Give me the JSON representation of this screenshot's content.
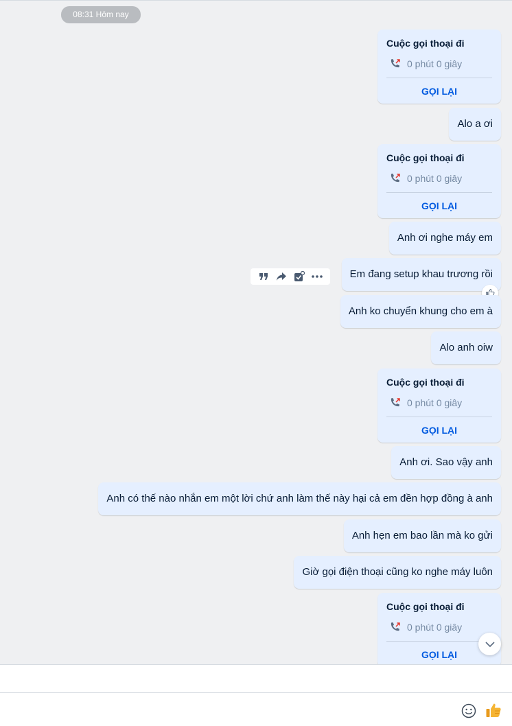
{
  "header": {
    "time_pill": "08:31 Hôm nay"
  },
  "call_card": {
    "title": "Cuộc gọi thoại đi",
    "duration": "0 phút 0 giây",
    "callback": "GỌI LẠI"
  },
  "messages": [
    {
      "type": "call"
    },
    {
      "type": "text",
      "text": "Alo a ơi"
    },
    {
      "type": "call"
    },
    {
      "type": "text",
      "text": "Anh ơi nghe máy em"
    },
    {
      "type": "text",
      "text": "Em đang setup khau trương rồi"
    },
    {
      "type": "text",
      "text": "Anh ko chuyển khung cho em à"
    },
    {
      "type": "text",
      "text": "Alo anh oiw"
    },
    {
      "type": "call"
    },
    {
      "type": "text",
      "text": "Anh ơi. Sao vậy anh"
    },
    {
      "type": "text",
      "text": "Anh có thế nào nhắn em một lời chứ  anh làm thế này hại cả em đền hợp đồng à anh"
    },
    {
      "type": "text",
      "text": "Anh hẹn em bao lần mà ko gửi"
    },
    {
      "type": "text",
      "text": "Giờ gọi điện thoại cũng ko nghe máy luôn"
    },
    {
      "type": "call"
    }
  ],
  "hover_actions": [
    "quote-icon",
    "share-icon",
    "task-icon",
    "more-icon"
  ],
  "icons": {
    "reaction": "thumbs-up-outline-icon",
    "scroll": "chevron-down-icon",
    "emoji": "emoji-icon",
    "send_like": "thumbs-up-icon"
  },
  "colors": {
    "bubble": "#e5efff",
    "background": "#eff0f2",
    "link": "#005ae0",
    "missed_arrow": "#e5392e",
    "thumb": "#f5b433"
  }
}
